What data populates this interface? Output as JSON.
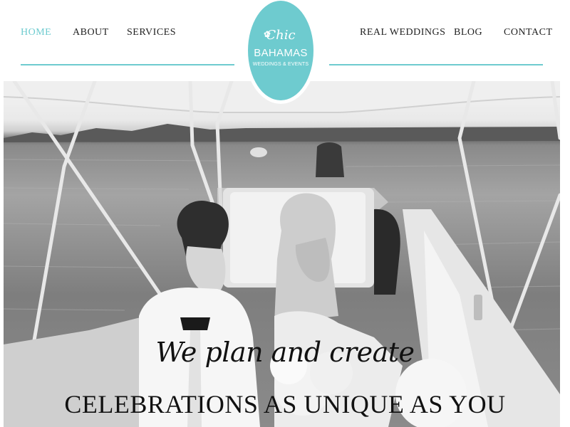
{
  "nav": {
    "left": [
      {
        "label": "HOME"
      },
      {
        "label": "ABOUT"
      },
      {
        "label": "SERVICES"
      }
    ],
    "right": [
      {
        "label": "REAL WEDDINGS"
      },
      {
        "label": "BLOG"
      },
      {
        "label": "CONTACT"
      }
    ]
  },
  "logo": {
    "script": "Chic",
    "main": "BAHAMAS",
    "sub": "WEDDINGS & EVENTS",
    "flower": "✿"
  },
  "hero": {
    "tagline_script": "We plan and create",
    "tagline_main": "CELEBRATIONS AS UNIQUE AS YOU"
  },
  "colors": {
    "accent": "#6ecbcf",
    "nav_text": "#222222",
    "tagline": "#111111"
  }
}
